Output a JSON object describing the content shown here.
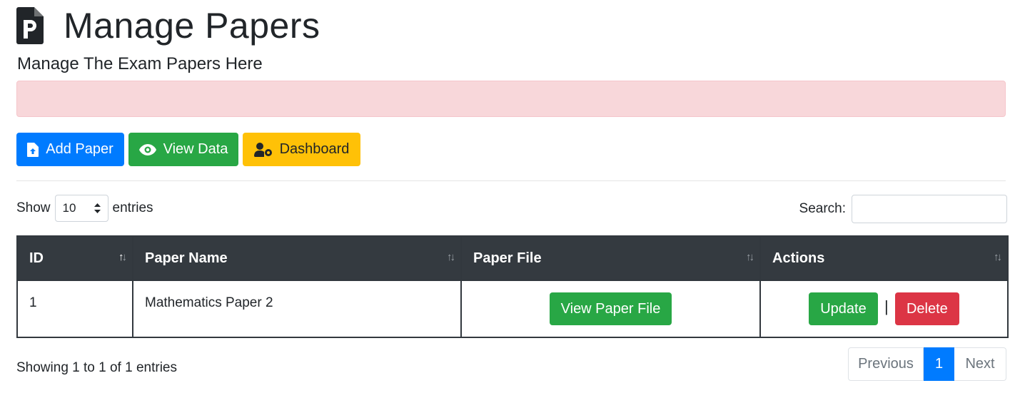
{
  "header": {
    "title": "Manage Papers",
    "subtitle": "Manage The Exam Papers Here"
  },
  "toolbar": {
    "add_label": "Add Paper",
    "view_label": "View Data",
    "dashboard_label": "Dashboard"
  },
  "table_controls": {
    "show_label": "Show",
    "entries_value": "10",
    "entries_label": "entries",
    "search_label": "Search:"
  },
  "table": {
    "columns": [
      "ID",
      "Paper Name",
      "Paper File",
      "Actions"
    ],
    "rows": [
      {
        "id": "1",
        "name": "Mathematics Paper 2",
        "file_button": "View Paper File",
        "update_label": "Update",
        "separator": "|",
        "delete_label": "Delete"
      }
    ]
  },
  "footer": {
    "info": "Showing 1 to 1 of 1 entries",
    "prev": "Previous",
    "current_page": "1",
    "next": "Next"
  },
  "colors": {
    "primary": "#007bff",
    "success": "#28a745",
    "warning": "#ffc107",
    "danger": "#dc3545",
    "dark": "#343a40",
    "alert_bg": "#f8d7da"
  },
  "icons": [
    "file-powerpoint-icon",
    "file-upload-icon",
    "eye-icon",
    "user-cog-icon",
    "sort-icon"
  ]
}
